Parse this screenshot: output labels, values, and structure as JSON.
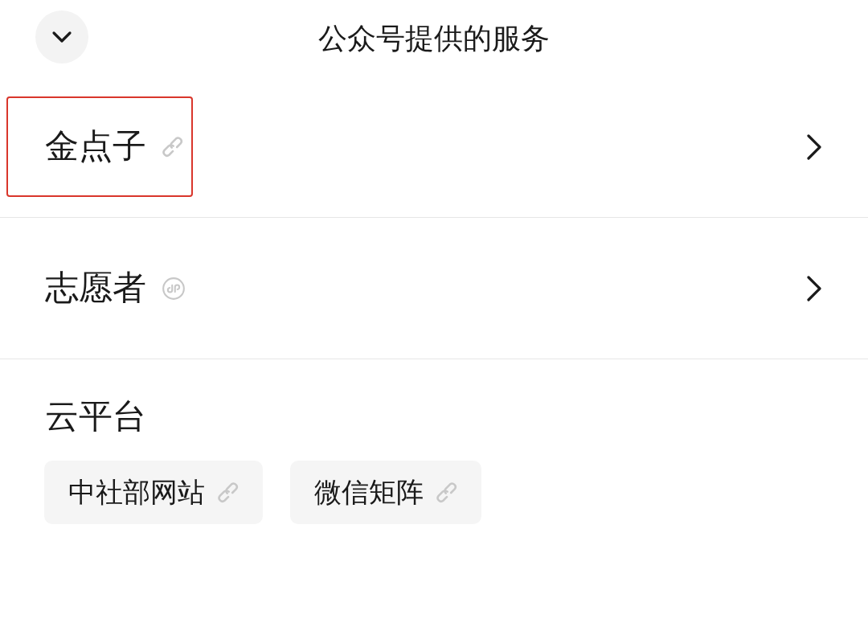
{
  "header": {
    "title": "公众号提供的服务"
  },
  "services": [
    {
      "label": "金点子",
      "kind": "link",
      "highlighted": true
    },
    {
      "label": "志愿者",
      "kind": "miniprogram",
      "highlighted": false
    }
  ],
  "group": {
    "title": "云平台",
    "chips": [
      {
        "label": "中社部网站",
        "kind": "link"
      },
      {
        "label": "微信矩阵",
        "kind": "link"
      }
    ]
  }
}
